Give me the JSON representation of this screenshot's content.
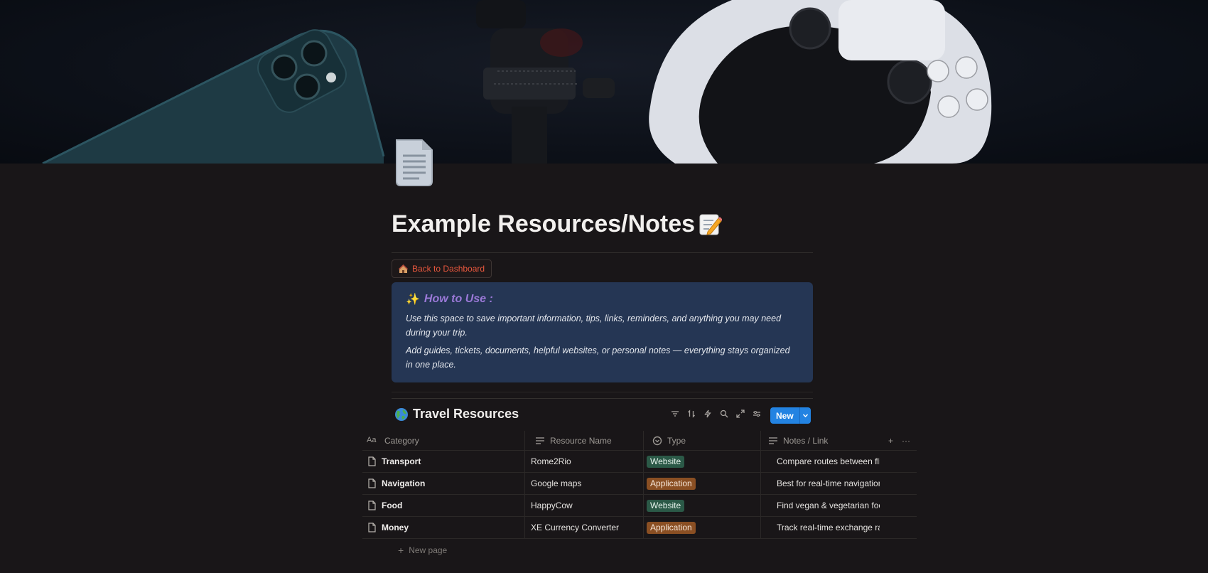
{
  "page": {
    "title": "Example Resources/Notes",
    "title_emoji": "memo-icon",
    "page_icon": "document-icon",
    "cover": "dark photo of smartphone, camera tripod and game controller"
  },
  "back_button": {
    "label": "Back to Dashboard",
    "icon": "house-icon",
    "color": "#e8573d"
  },
  "callout": {
    "heading": "How to Use :",
    "heading_icon": "sparkles-icon",
    "paragraphs": [
      "Use this space to save important information, tips, links, reminders, and anything you may need during your trip.",
      "Add guides, tickets, documents, helpful websites, or personal notes — everything stays organized in one place."
    ],
    "background": "#253654"
  },
  "database": {
    "title": "Travel Resources",
    "title_icon": "globe-icon",
    "toolbar": [
      "filter-icon",
      "sort-icon",
      "automation-icon",
      "search-icon",
      "expand-icon",
      "settings-icon"
    ],
    "new_label": "New",
    "columns": [
      "Category",
      "Resource Name",
      "Type",
      "Notes / Link"
    ],
    "rows": [
      {
        "category": "Transport",
        "resource": "Rome2Rio",
        "type": "Website",
        "notes": "Compare routes between flight"
      },
      {
        "category": "Navigation",
        "resource": "Google maps",
        "type": "Application",
        "notes": "Best for real-time navigation &"
      },
      {
        "category": "Food",
        "resource": "HappyCow",
        "type": "Website",
        "notes": "Find vegan & vegetarian food o"
      },
      {
        "category": "Money",
        "resource": "XE Currency Converter",
        "type": "Application",
        "notes": "Track real-time exchange rates."
      }
    ],
    "type_colors": {
      "Website": {
        "bg": "#2b5947",
        "fg": "#e6f3ec"
      },
      "Application": {
        "bg": "#8a4f23",
        "fg": "#f6e6d8"
      }
    },
    "new_page_label": "New page"
  }
}
